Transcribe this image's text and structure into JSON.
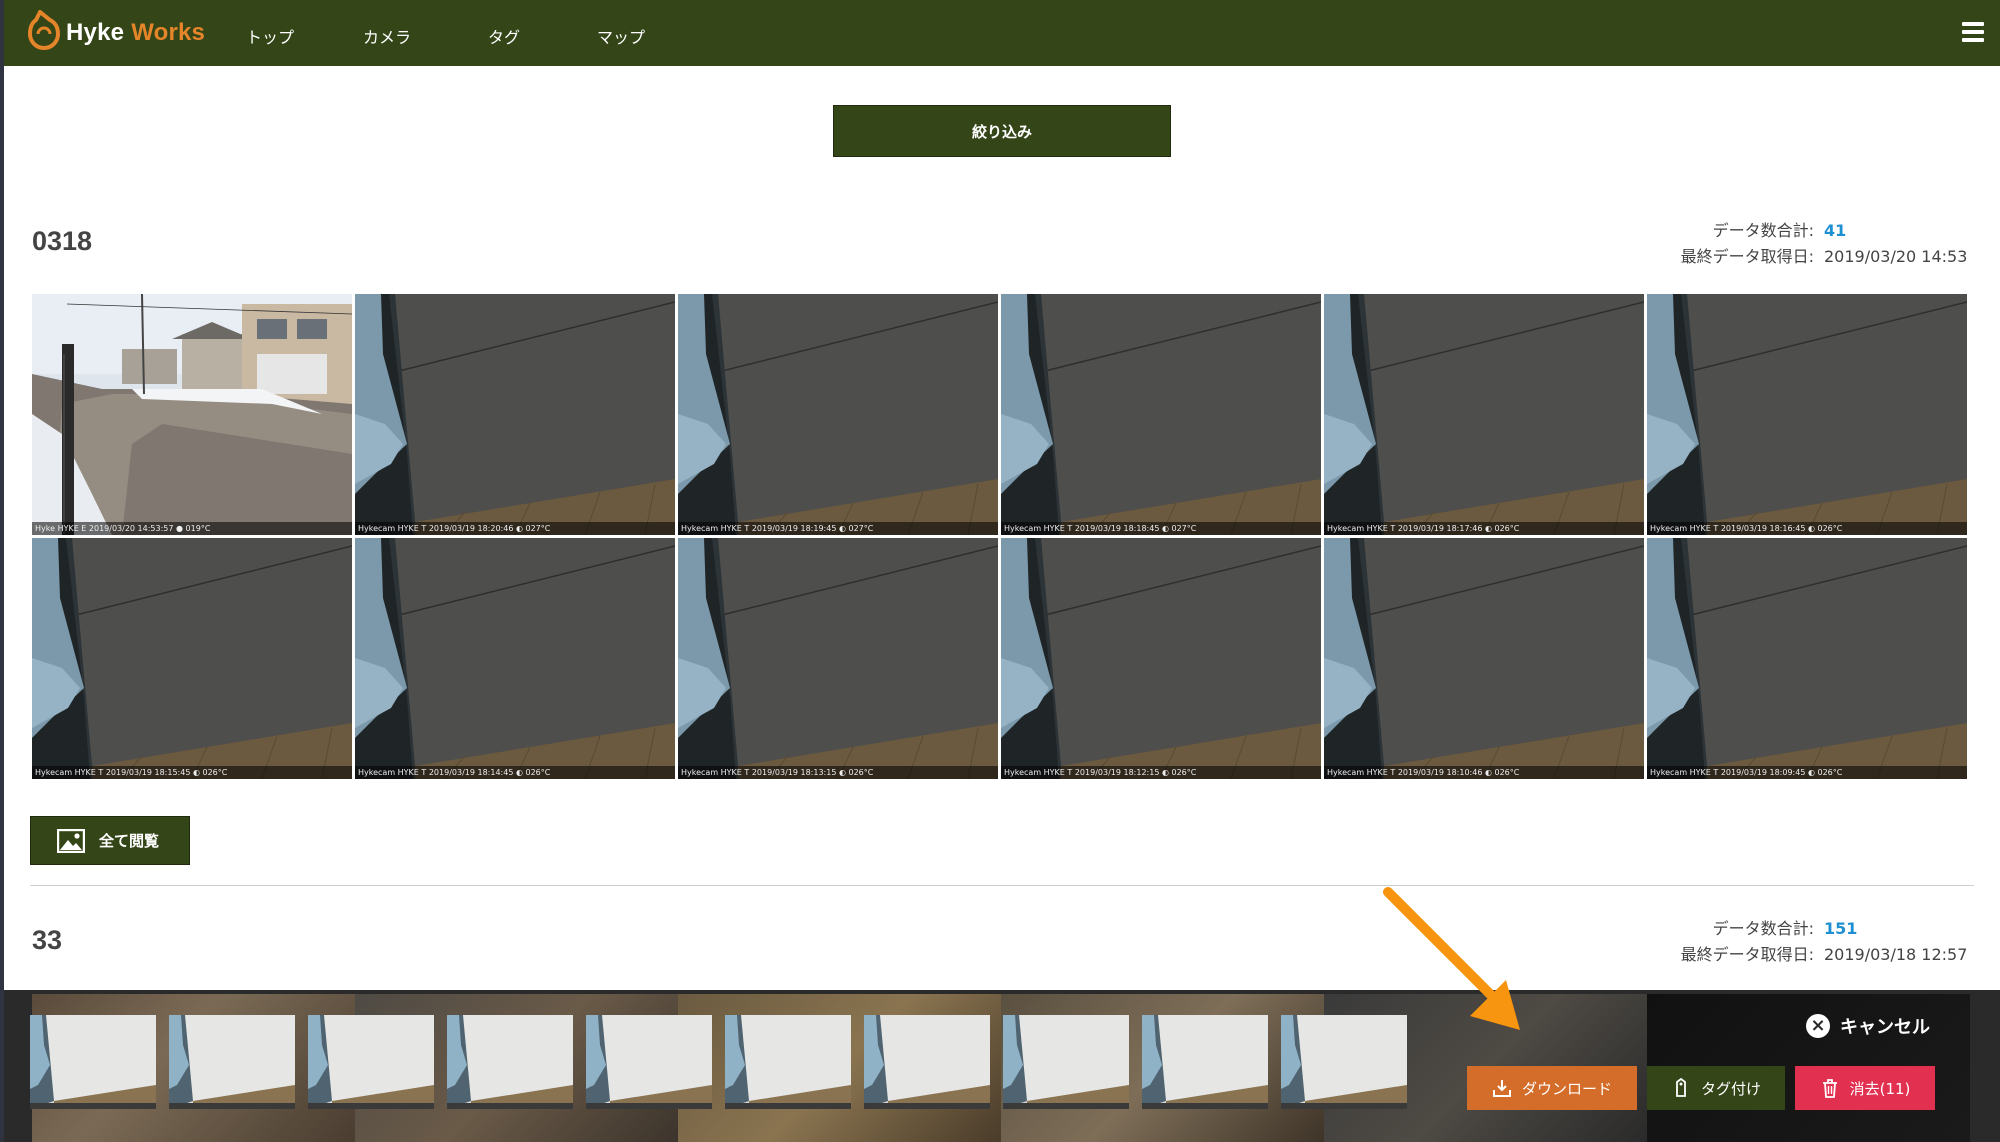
{
  "brand": {
    "name_part1": "Hyke",
    "name_part2": "Works",
    "accent": "#e58529"
  },
  "nav": {
    "items": [
      "トップ",
      "カメラ",
      "タグ",
      "マップ"
    ],
    "menu_icon": "hamburger-icon"
  },
  "colors": {
    "nav_bg": "#344518",
    "link": "#1e8fd1",
    "download": "#d56d2a",
    "delete": "#e23050"
  },
  "filter": {
    "label": "絞り込み"
  },
  "groups": [
    {
      "title": "0318",
      "count_label": "データ数合計:",
      "count_value": "41",
      "last_label": "最終データ取得日:",
      "last_value": "2019/03/20 14:53",
      "thumbnails": [
        {
          "caption": "Hyke      HYKE      E      2019/03/20 14:53:57   ● 019°C",
          "scene": "street"
        },
        {
          "caption": "Hykecam   HYKE    T    2019/03/19 18:20:46   ◐ 027°C",
          "scene": "wall"
        },
        {
          "caption": "Hykecam   HYKE    T    2019/03/19 18:19:45   ◐ 027°C",
          "scene": "wall"
        },
        {
          "caption": "Hykecam   HYKE    T    2019/03/19 18:18:45   ◐ 027°C",
          "scene": "wall"
        },
        {
          "caption": "Hykecam   HYKE    T    2019/03/19 18:17:46   ◐ 026°C",
          "scene": "wall"
        },
        {
          "caption": "Hykecam   HYKE    T    2019/03/19 18:16:45   ◐ 026°C",
          "scene": "wall"
        },
        {
          "caption": "Hykecam   HYKE    T    2019/03/19 18:15:45   ◐ 026°C",
          "scene": "wall"
        },
        {
          "caption": "Hykecam   HYKE    T    2019/03/19 18:14:45   ◐ 026°C",
          "scene": "wall"
        },
        {
          "caption": "Hykecam   HYKE    T    2019/03/19 18:13:15   ◐ 026°C",
          "scene": "wall"
        },
        {
          "caption": "Hykecam   HYKE    T    2019/03/19 18:12:15   ◐ 026°C",
          "scene": "wall"
        },
        {
          "caption": "Hykecam   HYKE    T    2019/03/19 18:10:46   ◐ 026°C",
          "scene": "wall"
        },
        {
          "caption": "Hykecam   HYKE    T    2019/03/19 18:09:45   ◐ 026°C",
          "scene": "wall"
        }
      ],
      "view_all_label": "全て閲覧"
    },
    {
      "title": "33",
      "count_label": "データ数合計:",
      "count_value": "151",
      "last_label": "最終データ取得日:",
      "last_value": "2019/03/18 12:57"
    }
  ],
  "selection_bar": {
    "selected_count": 10,
    "cancel_label": "キャンセル",
    "download_label": "ダウンロード",
    "tag_label": "タグ付け",
    "delete_label": "消去(11)"
  }
}
